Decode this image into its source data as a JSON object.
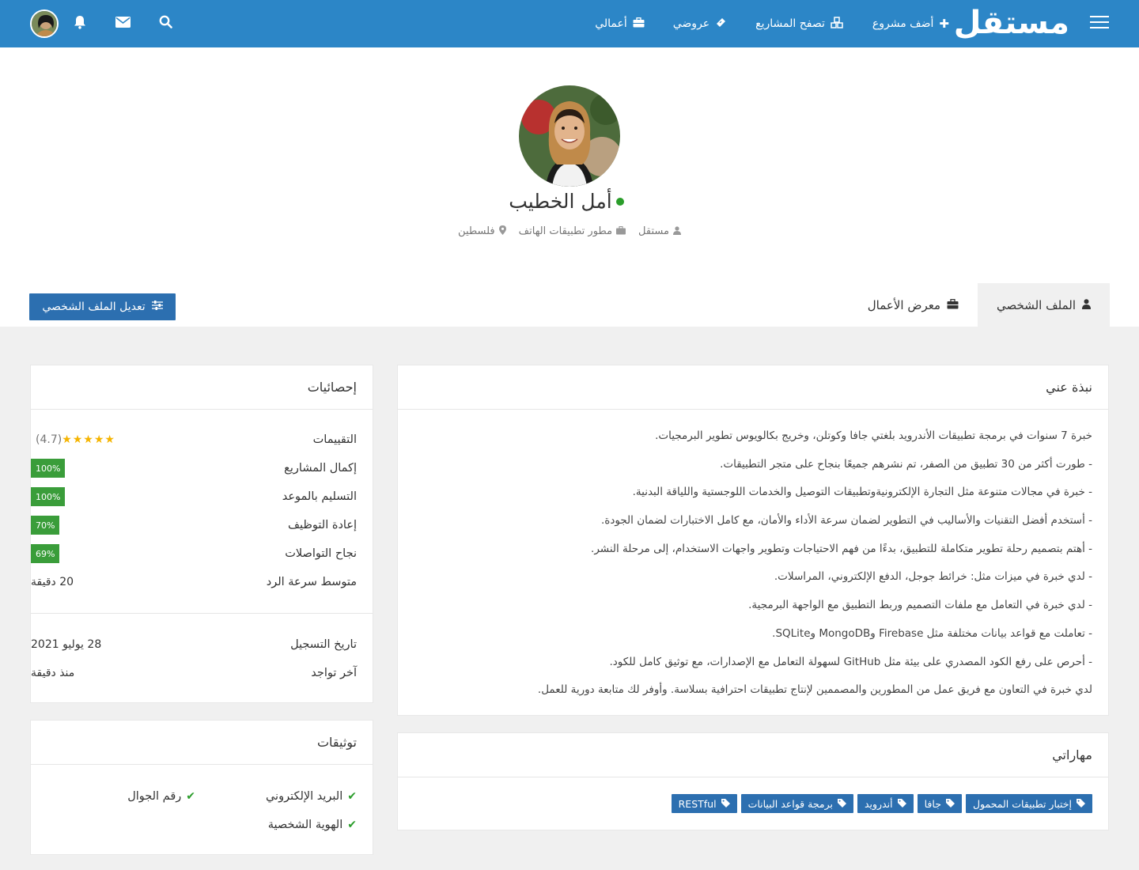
{
  "nav": {
    "logo": "مستقل",
    "links": [
      {
        "label": "أضف مشروع",
        "icon": "plus-icon"
      },
      {
        "label": "تصفح المشاريع",
        "icon": "cubes-icon"
      },
      {
        "label": "عروضي",
        "icon": "ticket-icon"
      },
      {
        "label": "أعمالي",
        "icon": "briefcase-icon"
      }
    ],
    "icons": [
      "search-icon",
      "envelope-icon",
      "bell-icon",
      "avatar"
    ]
  },
  "profile": {
    "name": "أمل الخطيب",
    "online": true,
    "meta": {
      "platform": "مستقل",
      "job": "مطور تطبيقات الهاتف",
      "location": "فلسطين"
    },
    "tabs": [
      {
        "label": "الملف الشخصي",
        "icon": "user-icon",
        "active": true
      },
      {
        "label": "معرض الأعمال",
        "icon": "briefcase-icon",
        "active": false
      }
    ],
    "edit_button": "تعديل الملف الشخصي"
  },
  "about": {
    "title": "نبذة عني",
    "lines": [
      "خبرة 7 سنوات في برمجة تطبيقات الأندرويد بلغتي جافا وكوتلن، وخريج بكالويوس تطوير البرمجيات.",
      "- طورت أكثر من 30 تطبيق من الصفر، تم نشرهم جميعًا بنجاح على متجر التطبيقات.",
      "- خبرة في مجالات متنوعة مثل التجارة الإلكترونيةوتطبيقات التوصيل والخدمات اللوجستية واللياقة البدنية.",
      "- أستخدم أفضل التقنيات والأساليب في التطوير لضمان سرعة الأداء والأمان، مع كامل الاختبارات لضمان الجودة.",
      "- أهتم بتصميم رحلة تطوير متكاملة للتطبيق، بدءًا من فهم الاحتياجات وتطوير واجهات الاستخدام، إلى مرحلة النشر.",
      "- لدي خبرة في ميزات مثل: خرائط جوجل، الدفع الإلكتروني، المراسلات.",
      "- لدي خبرة في التعامل مع ملفات التصميم وربط التطبيق مع الواجهة البرمجية.",
      "- تعاملت مع قواعد بيانات مختلفة مثل Firebase وMongoDB وSQLite.",
      "- أحرص على رفع الكود المصدري على بيئة مثل GitHub لسهولة التعامل مع الإصدارات، مع توثيق كامل للكود.",
      "لدي خبرة في التعاون مع فريق عمل من المطورين والمصممين لإنتاج تطبيقات احترافية بسلاسة. وأوفر لك متابعة دورية للعمل."
    ]
  },
  "skills": {
    "title": "مهاراتي",
    "items": [
      "إختبار تطبيقات المحمول",
      "جافا",
      "أندرويد",
      "برمجة قواعد البيانات",
      "RESTful"
    ]
  },
  "stats": {
    "title": "إحصائيات",
    "rating_label": "التقييمات",
    "rating_value": 4.7,
    "rating_text": "(4.7)",
    "stars": "★★★★★",
    "rows": [
      {
        "label": "إكمال المشاريع",
        "value": "100%",
        "percent": 100
      },
      {
        "label": "التسليم بالموعد",
        "value": "100%",
        "percent": 100
      },
      {
        "label": "إعادة التوظيف",
        "value": "70%",
        "percent": 70
      },
      {
        "label": "نجاح التواصلات",
        "value": "69%",
        "percent": 69
      }
    ],
    "response_label": "متوسط سرعة الرد",
    "response_value": "20 دقيقة",
    "registered_label": "تاريخ التسجيل",
    "registered_value": "28 يوليو 2021",
    "last_seen_label": "آخر تواجد",
    "last_seen_value": "منذ دقيقة"
  },
  "verify": {
    "title": "توثيقات",
    "items": [
      "البريد الإلكتروني",
      "رقم الجوال",
      "الهوية الشخصية"
    ]
  },
  "colors": {
    "navbar": "#2c86c7",
    "button": "#2c6fb0",
    "badge": "#3a9d3a",
    "online": "#2a9d2a",
    "stars": "#f5b400"
  }
}
